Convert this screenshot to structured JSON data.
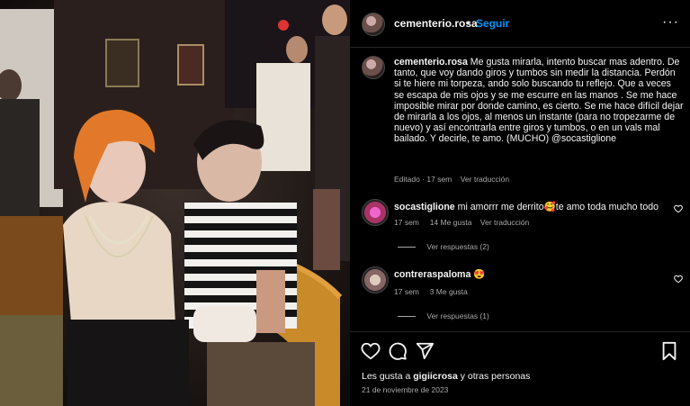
{
  "post": {
    "username": "cementerio.rosa",
    "separator": "•",
    "follow_label": "Seguir",
    "more_label": "···"
  },
  "caption": {
    "username": "cementerio.rosa",
    "text": "Me gusta mirarla, intento buscar mas adentro. De tanto, que voy dando giros y tumbos sin medir la distancia. Perdón si te hiere mi torpeza, ando solo buscando tu reflejo. Que a veces se escapa de mis ojos y se me escurre en las manos . Se me hace imposible mirar por donde camino, es cierto. Se me hace difícil dejar de mirarla a los ojos, al menos un instante (para no tropezarme de nuevo) y así encontrarla entre giros y tumbos, o en un vals mal bailado. Y decirle, te amo. (MUCHO) @socastiglione",
    "edited": "Editado · 17 sem",
    "translate": "Ver traducción"
  },
  "comments": [
    {
      "username": "socastiglione",
      "text": "mi amorrr me derrito🥰te amo toda mucho todo",
      "time": "17 sem",
      "likes": "14 Me gusta",
      "translate": "Ver traducción",
      "replies": "Ver respuestas (2)"
    },
    {
      "username": "contreraspaloma",
      "text": "😍",
      "time": "17 sem",
      "likes": "3 Me gusta",
      "replies": "Ver respuestas (1)"
    }
  ],
  "footer": {
    "likes_prefix": "Les gusta a ",
    "likes_user": "gigiicrosa",
    "likes_suffix": " y otras personas",
    "date": "21 de noviembre de 2023"
  },
  "icons": {
    "like": "heart-icon",
    "comment": "comment-icon",
    "share": "share-icon",
    "save": "bookmark-icon"
  },
  "colors": {
    "link": "#0095f6",
    "text": "#f5f5f5",
    "secondary": "#a8a8a8",
    "background": "#000000"
  }
}
